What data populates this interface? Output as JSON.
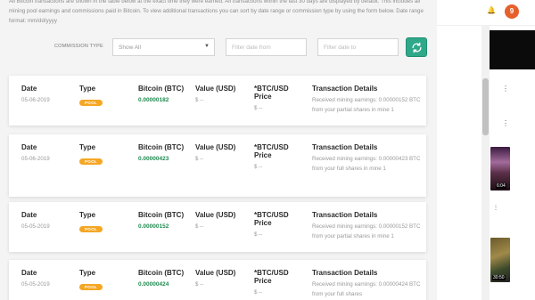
{
  "intro_text": "All Bitcoin transactions are shown in the table below at the exact time they were earned. All transactions within the last 30 days are displayed by default. This includes all mining pool earnings and commissions paid in Bitcoin. To view additional transactions you can sort by date range or commission type by using the form below. Date range format: mm/dd/yyyy",
  "filters": {
    "commission_label": "COMMISSION TYPE",
    "commission_value": "Show All",
    "date_from_placeholder": "Filter date from",
    "date_to_placeholder": "Filter date to",
    "refresh_icon": "refresh-icon"
  },
  "headers": {
    "date": "Date",
    "type": "Type",
    "bitcoin": "Bitcoin (BTC)",
    "value": "Value (USD)",
    "price": "*BTC/USD Price",
    "details": "Transaction Details"
  },
  "transactions": [
    {
      "date": "05-06-2019",
      "type": "POOL",
      "btc": "0.00000182",
      "value": "$ --",
      "price": "$ --",
      "details": "Received mining earnings: 0.00000152 BTC from your partial shares in mine 1"
    },
    {
      "date": "05-06-2019",
      "type": "POOL",
      "btc": "0.00000423",
      "value": "$ --",
      "price": "$ --",
      "details": "Received mining earnings: 0.00000423 BTC from your full shares in mine 1"
    },
    {
      "date": "05-05-2019",
      "type": "POOL",
      "btc": "0.00000152",
      "value": "$ --",
      "price": "$ --",
      "details": "Received mining earnings: 0.00000152 BTC from your partial shares in mine 1"
    },
    {
      "date": "05-05-2019",
      "type": "POOL",
      "btc": "0.00000424",
      "value": "$ --",
      "price": "$ --",
      "details": "Received mining earnings: 0.00000424 BTC from your full shares"
    }
  ],
  "side": {
    "avatar_letter": "9",
    "durations": [
      "6:04",
      "30:50"
    ],
    "colors": {
      "accent": "#2fa889",
      "pill": "#f5a623",
      "btc": "#1e8a4f",
      "avatar": "#e6602b"
    }
  }
}
